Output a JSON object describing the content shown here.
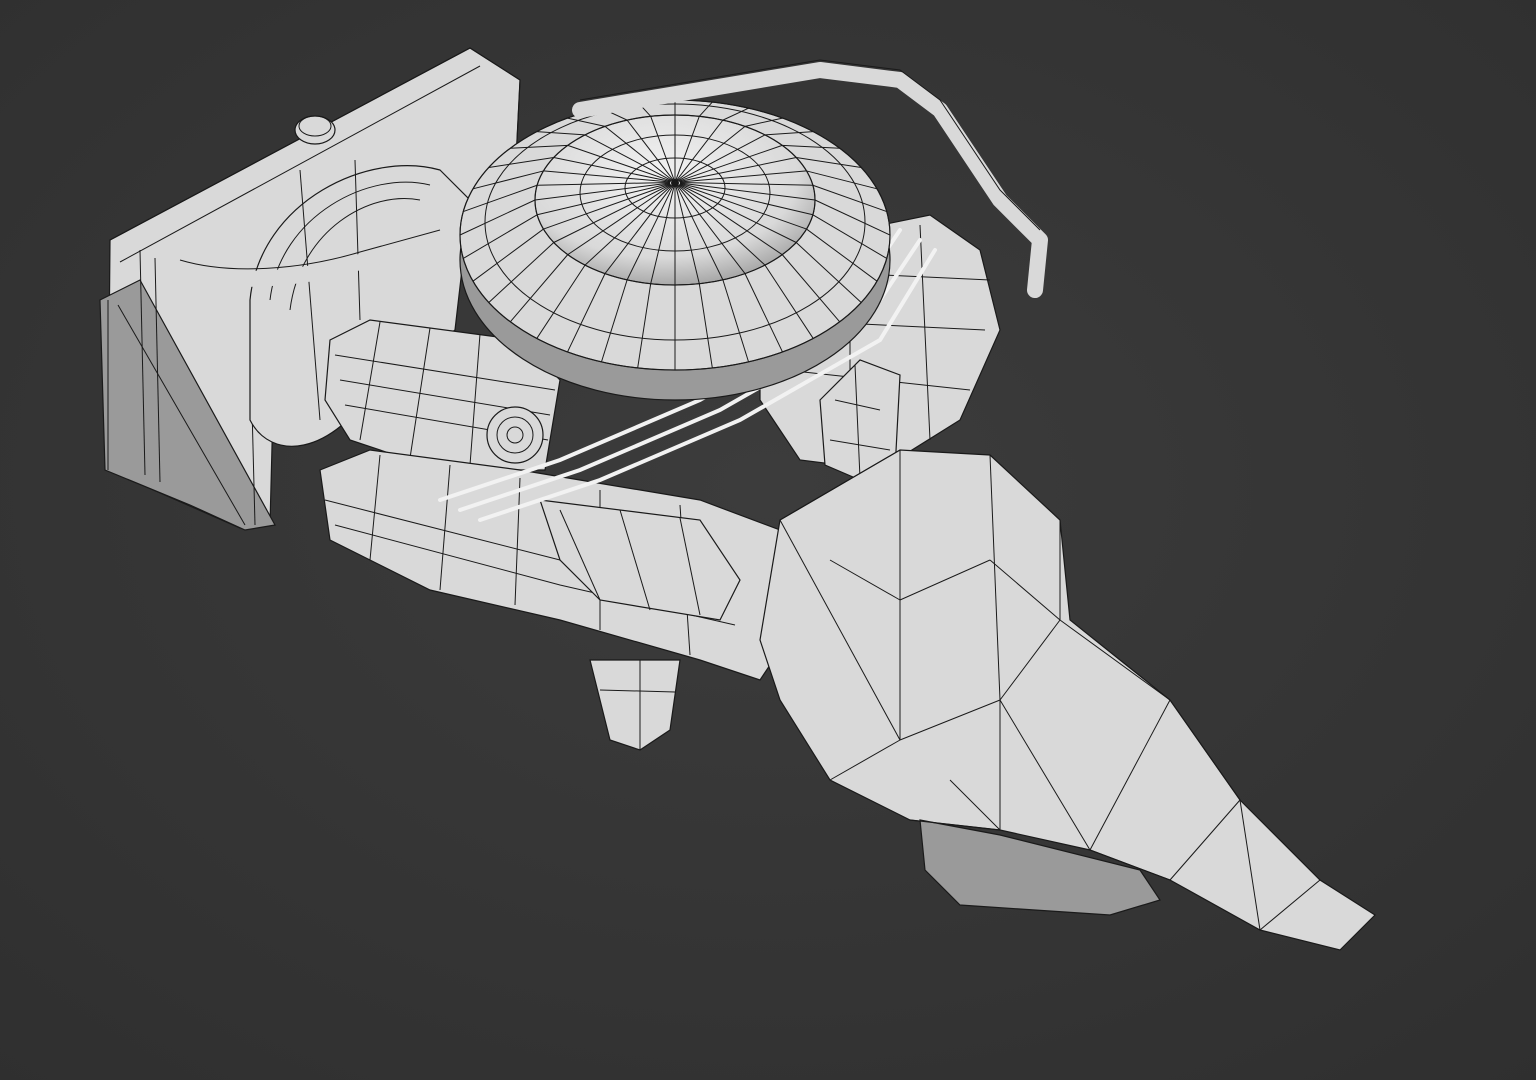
{
  "viewport": {
    "background": "#3c3c3c",
    "vignette": "#2f2f2f"
  },
  "model": {
    "subject": "engine-wireframe-render",
    "surface_color": "#d9d9d9",
    "highlight_color": "#f2f2f2",
    "shadow_color": "#9a9a9a",
    "wire_color": "#1a1a1a"
  }
}
